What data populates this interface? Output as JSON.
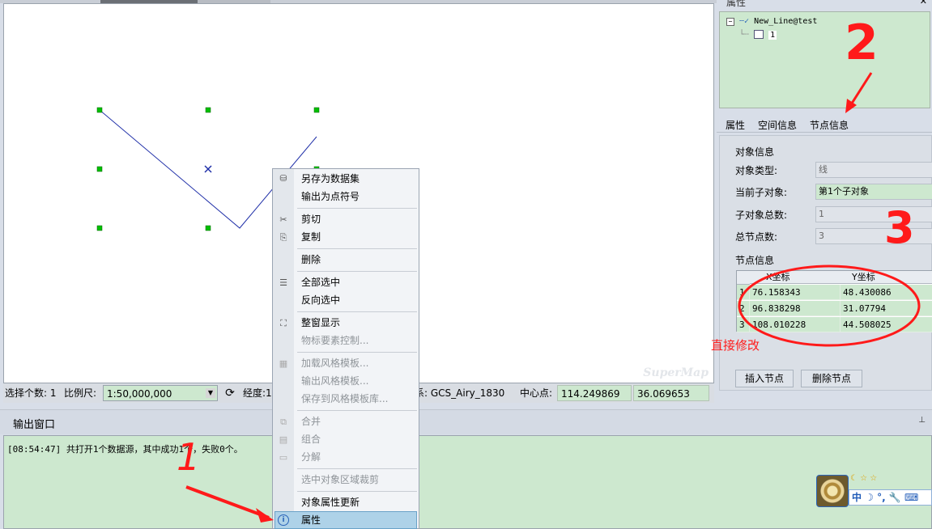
{
  "map": {
    "watermark": "SuperMap",
    "colors": {
      "line": "#1f2fa8",
      "handle": "#00c000",
      "center": "#1f2fa8"
    }
  },
  "statusbar": {
    "selected_count_label": "选择个数: 1",
    "scale_label": "比例尺:",
    "scale_value": "1:50,000,000",
    "longitude_label": "经度:10",
    "crs_label": "系: GCS_Airy_1830",
    "center_label": "中心点:",
    "center_x": "114.249869",
    "center_y": "36.069653"
  },
  "output": {
    "title": "输出窗口",
    "pin_icon": "pin-icon",
    "log_line": "[08:54:47] 共打开1个数据源，其中成功1个，失败0个。"
  },
  "right_panel": {
    "title": "属性",
    "tree": {
      "dataset": "New_Line@test",
      "record": "1"
    },
    "tabs": [
      "属性",
      "空间信息",
      "节点信息"
    ],
    "object_info": {
      "section": "对象信息",
      "type_label": "对象类型:",
      "type_value": "线",
      "sub_label": "当前子对象:",
      "sub_value": "第1个子对象",
      "sub_total_label": "子对象总数:",
      "sub_total_value": "1",
      "node_total_label": "总节点数:",
      "node_total_value": "3"
    },
    "node_info": {
      "section": "节点信息",
      "columns": [
        "X坐标",
        "Y坐标"
      ],
      "rows": [
        {
          "idx": "1",
          "x": "76.158343",
          "y": "48.430086"
        },
        {
          "idx": "2",
          "x": "96.838298",
          "y": "31.07794"
        },
        {
          "idx": "3",
          "x": "108.010228",
          "y": "44.508025"
        }
      ]
    },
    "buttons": {
      "insert": "插入节点",
      "delete": "删除节点"
    }
  },
  "context_menu": {
    "items": [
      {
        "label": "另存为数据集",
        "enabled": true,
        "icon": "database-icon"
      },
      {
        "label": "输出为点符号",
        "enabled": true
      },
      {
        "label": "剪切",
        "enabled": true,
        "icon": "scissors-icon"
      },
      {
        "label": "复制",
        "enabled": true,
        "icon": "copy-icon"
      },
      {
        "label": "删除",
        "enabled": true
      },
      {
        "label": "全部选中",
        "enabled": true,
        "icon": "select-all-icon"
      },
      {
        "label": "反向选中",
        "enabled": true
      },
      {
        "label": "整窗显示",
        "enabled": true,
        "icon": "full-extent-icon"
      },
      {
        "label": "物标要素控制...",
        "enabled": false
      },
      {
        "label": "加载风格模板...",
        "enabled": false,
        "icon": "style-template-icon"
      },
      {
        "label": "输出风格模板...",
        "enabled": false
      },
      {
        "label": "保存到风格模板库...",
        "enabled": false
      },
      {
        "label": "合并",
        "enabled": false,
        "icon": "merge-icon"
      },
      {
        "label": "组合",
        "enabled": false,
        "icon": "group-icon"
      },
      {
        "label": "分解",
        "enabled": false,
        "icon": "ungroup-icon"
      },
      {
        "label": "选中对象区域裁剪",
        "enabled": false
      },
      {
        "label": "对象属性更新",
        "enabled": true
      },
      {
        "label": "属性",
        "enabled": true,
        "icon": "info-icon",
        "highlighted": true
      }
    ]
  },
  "annotations": {
    "step1": "1",
    "step2": "2",
    "step3": "3",
    "edit_note": "直接修改"
  },
  "ime": {
    "text": "中 ☽ °, 🔧 ⌨"
  }
}
